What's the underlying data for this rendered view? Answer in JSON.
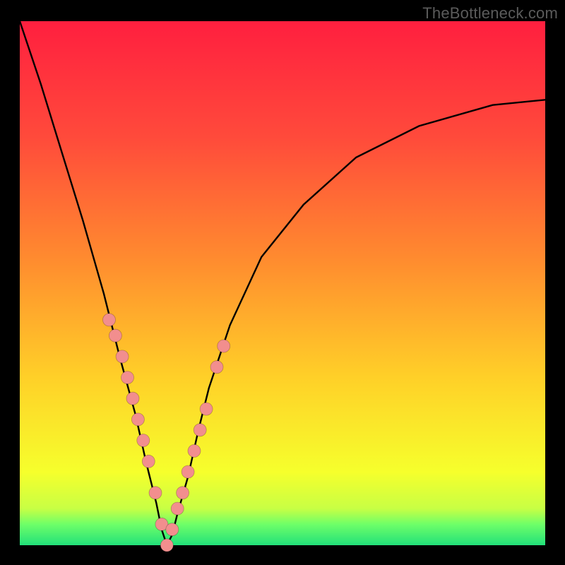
{
  "watermark": "TheBottleneck.com",
  "colors": {
    "background": "#000000",
    "curve": "#000000",
    "marker": "#f28e8e",
    "gradient_stops": [
      "#ff1f3f",
      "#ff4a3b",
      "#ff8a2f",
      "#ffd028",
      "#f6ff2c",
      "#c8ff44",
      "#6eff68",
      "#22e07a"
    ]
  },
  "layout": {
    "outer_width": 800,
    "outer_height": 800,
    "inner_left": 28,
    "inner_top": 30,
    "inner_width": 744,
    "inner_height": 742,
    "watermark_right": 10,
    "watermark_top": 6
  },
  "chart_data": {
    "type": "line",
    "title": "",
    "xlabel": "",
    "ylabel": "",
    "xlim": [
      0,
      100
    ],
    "ylim": [
      0,
      100
    ],
    "grid": false,
    "vertex_x": 28,
    "series": [
      {
        "name": "bottleneck-curve",
        "x": [
          0,
          4,
          8,
          12,
          16,
          19,
          22,
          24,
          26,
          27,
          28,
          29,
          30,
          32,
          34,
          36,
          40,
          46,
          54,
          64,
          76,
          90,
          100
        ],
        "values": [
          100,
          88,
          75,
          62,
          48,
          36,
          25,
          16,
          8,
          3,
          0,
          2,
          6,
          13,
          22,
          30,
          42,
          55,
          65,
          74,
          80,
          84,
          85
        ]
      }
    ],
    "markers": {
      "name": "highlight-dots",
      "x": [
        17,
        18.2,
        19.5,
        20.5,
        21.5,
        22.5,
        23.5,
        24.5,
        25.8,
        27,
        28,
        29,
        30,
        31,
        32,
        33.2,
        34.3,
        35.5,
        37.5,
        38.8
      ],
      "values": [
        43,
        40,
        36,
        32,
        28,
        24,
        20,
        16,
        10,
        4,
        0,
        3,
        7,
        10,
        14,
        18,
        22,
        26,
        34,
        38
      ]
    }
  }
}
